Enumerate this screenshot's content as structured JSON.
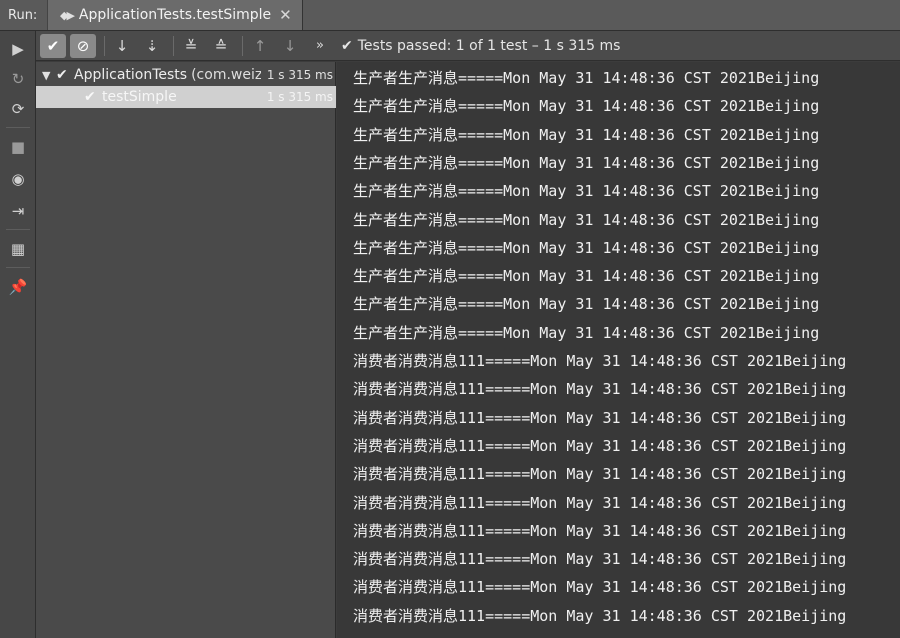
{
  "tabbar": {
    "run_label": "Run:",
    "tab_title": "ApplicationTests.testSimple",
    "tab_icon": "◆▶",
    "tab_close": "✕"
  },
  "toolbar": {
    "status_text": "Tests passed: 1 of 1 test – 1 s 315 ms",
    "icons": {
      "show_passed": "✔",
      "show_ignored": "⊘",
      "sort_alpha": "↓",
      "sort_duration": "⇣",
      "expand_all": "≚",
      "collapse_all": "≙",
      "prev_failed": "↑",
      "next_failed": "↓",
      "more": "»",
      "status_check": "✔"
    }
  },
  "rail": {
    "icons": {
      "rerun": "▶",
      "rerun_failed": "↻",
      "toggle_auto_test": "⟳",
      "stop": "■",
      "export": "◉",
      "import": "⇥",
      "layout": "▦",
      "pin": "📌"
    }
  },
  "tree": {
    "root": {
      "name": "ApplicationTests",
      "package": "(com.weiz",
      "time": "1 s 315 ms"
    },
    "child": {
      "name": "testSimple",
      "time": "1 s 315 ms"
    }
  },
  "console": {
    "lines": [
      "生产者生产消息=====Mon May 31 14:48:36 CST 2021Beijing",
      "生产者生产消息=====Mon May 31 14:48:36 CST 2021Beijing",
      "生产者生产消息=====Mon May 31 14:48:36 CST 2021Beijing",
      "生产者生产消息=====Mon May 31 14:48:36 CST 2021Beijing",
      "生产者生产消息=====Mon May 31 14:48:36 CST 2021Beijing",
      "生产者生产消息=====Mon May 31 14:48:36 CST 2021Beijing",
      "生产者生产消息=====Mon May 31 14:48:36 CST 2021Beijing",
      "生产者生产消息=====Mon May 31 14:48:36 CST 2021Beijing",
      "生产者生产消息=====Mon May 31 14:48:36 CST 2021Beijing",
      "生产者生产消息=====Mon May 31 14:48:36 CST 2021Beijing",
      "消费者消费消息111=====Mon May 31 14:48:36 CST 2021Beijing",
      "消费者消费消息111=====Mon May 31 14:48:36 CST 2021Beijing",
      "消费者消费消息111=====Mon May 31 14:48:36 CST 2021Beijing",
      "消费者消费消息111=====Mon May 31 14:48:36 CST 2021Beijing",
      "消费者消费消息111=====Mon May 31 14:48:36 CST 2021Beijing",
      "消费者消费消息111=====Mon May 31 14:48:36 CST 2021Beijing",
      "消费者消费消息111=====Mon May 31 14:48:36 CST 2021Beijing",
      "消费者消费消息111=====Mon May 31 14:48:36 CST 2021Beijing",
      "消费者消费消息111=====Mon May 31 14:48:36 CST 2021Beijing",
      "消费者消费消息111=====Mon May 31 14:48:36 CST 2021Beijing"
    ]
  }
}
